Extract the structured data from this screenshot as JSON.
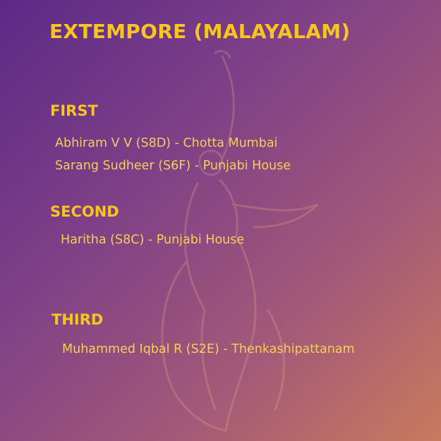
{
  "title": "EXTEMPORE (MALAYALAM)",
  "sections": [
    {
      "label": "FIRST",
      "entries": [
        "Abhiram V V (S8D) - Chotta Mumbai",
        "Sarang Sudheer (S6F) - Punjabi House"
      ]
    },
    {
      "label": "SECOND",
      "entries": [
        "Haritha (S8C) - Punjabi House"
      ]
    },
    {
      "label": "THIRD",
      "entries": [
        "Muhammed Iqbal R (S2E) - Thenkashipattanam"
      ]
    }
  ],
  "colors": {
    "accent": "#f7c51e",
    "text": "#f5cf57",
    "bg_start": "#5b2a86",
    "bg_end": "#c97a5e"
  },
  "decoration": "dancer-silhouette-icon"
}
